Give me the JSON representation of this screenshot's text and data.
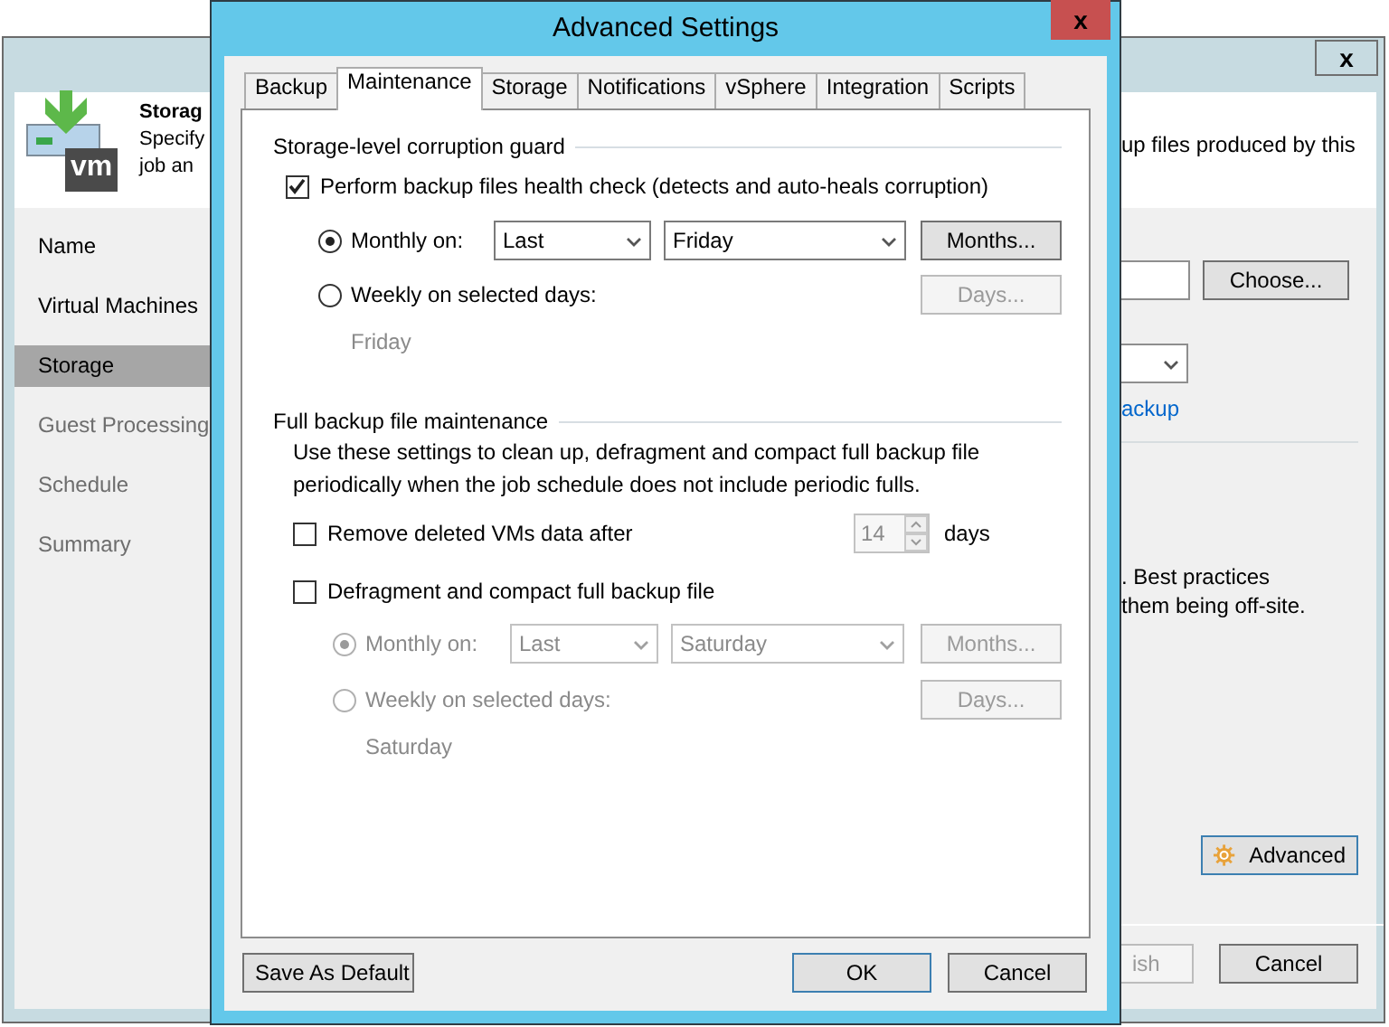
{
  "wizard": {
    "close_label": "x",
    "header": {
      "logo_text": "vm",
      "title": "Storag",
      "description": [
        "Specify",
        "job an"
      ],
      "description_right": "up files produced by this"
    },
    "steps": [
      {
        "label": "Name",
        "selected": false,
        "disabled": false
      },
      {
        "label": "Virtual Machines",
        "selected": false,
        "disabled": false
      },
      {
        "label": "Storage",
        "selected": true,
        "disabled": false
      },
      {
        "label": "Guest Processing",
        "selected": false,
        "disabled": true
      },
      {
        "label": "Schedule",
        "selected": false,
        "disabled": true
      },
      {
        "label": "Summary",
        "selected": false,
        "disabled": true
      }
    ],
    "choose_button": "Choose...",
    "link": "ackup",
    "note": [
      ". Best practices",
      "them being off-site."
    ],
    "advanced_button": "Advanced",
    "buttons": [
      {
        "label": "ish",
        "disabled": true
      },
      {
        "label": "Cancel",
        "disabled": false
      }
    ]
  },
  "dialog": {
    "title": "Advanced Settings",
    "close_label": "x",
    "tabs": [
      {
        "label": "Backup",
        "selected": false
      },
      {
        "label": "Maintenance",
        "selected": true
      },
      {
        "label": "Storage",
        "selected": false
      },
      {
        "label": "Notifications",
        "selected": false
      },
      {
        "label": "vSphere",
        "selected": false
      },
      {
        "label": "Integration",
        "selected": false
      },
      {
        "label": "Scripts",
        "selected": false
      }
    ],
    "corruption_guard": {
      "heading": "Storage-level corruption guard",
      "health_check": {
        "label": "Perform backup files health check (detects and auto-heals corruption)",
        "checked": true
      },
      "options": [
        {
          "kind": "monthly",
          "label": "Monthly on:",
          "selected": true,
          "week": "Last",
          "day": "Friday",
          "button": "Months..."
        },
        {
          "kind": "weekly",
          "label": "Weekly on selected days:",
          "selected": false,
          "button": "Days..."
        }
      ],
      "summary": "Friday"
    },
    "full_maintenance": {
      "heading": "Full backup file maintenance",
      "description": "Use these settings to clean up, defragment and compact full backup file\nperiodically when the job schedule does not include periodic fulls.",
      "remove_deleted": {
        "label": "Remove deleted VMs data after",
        "checked": false,
        "value": "14",
        "unit": "days"
      },
      "defragment": {
        "label": "Defragment and compact full backup file",
        "checked": false
      },
      "options": [
        {
          "kind": "monthly",
          "label": "Monthly on:",
          "selected": true,
          "week": "Last",
          "day": "Saturday",
          "button": "Months..."
        },
        {
          "kind": "weekly",
          "label": "Weekly on selected days:",
          "selected": false,
          "button": "Days..."
        }
      ],
      "summary": "Saturday"
    },
    "buttons": [
      {
        "label": "Save As Default",
        "kind": "normal"
      },
      {
        "label": "OK",
        "kind": "default"
      },
      {
        "label": "Cancel",
        "kind": "normal"
      }
    ]
  }
}
